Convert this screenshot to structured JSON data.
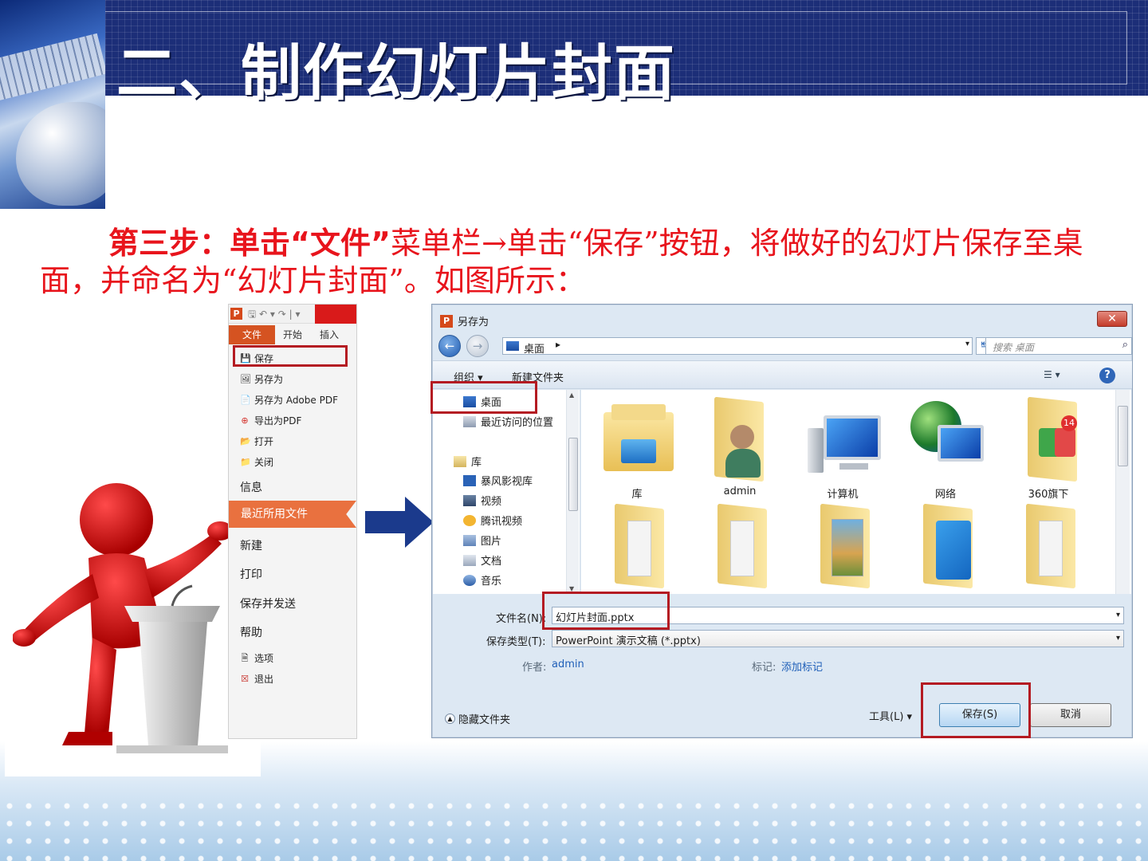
{
  "slide": {
    "title": "二、制作幻灯片封面",
    "instruction_lead": "第三步：单击“文件”",
    "instruction_rest": "菜单栏→单击“保存”按钮，将做好的幻灯片保存至桌面，并命名为“幻灯片封面”。如图所示："
  },
  "colors": {
    "title_bar": "#1c2e78",
    "instruction_text": "#e8141c",
    "highlight_box": "#b41b22",
    "file_tab": "#d55321",
    "recent_active": "#e9713f",
    "arrow": "#1b3a8c"
  },
  "backstage": {
    "app_icon": "P",
    "quick_access_glyphs": "🖫 ↶ ▾ ↷ | ▾",
    "tabs": {
      "file": "文件",
      "home": "开始",
      "insert": "插入"
    },
    "items": [
      {
        "label": "保存",
        "icon": "save-icon",
        "glyph": "💾"
      },
      {
        "label": "另存为",
        "icon": "save-as-icon",
        "glyph": "🖼"
      },
      {
        "label": "另存为 Adobe PDF",
        "icon": "adobe-pdf-icon",
        "glyph": "📄"
      },
      {
        "label": "导出为PDF",
        "icon": "export-pdf-icon",
        "glyph": "⊕"
      },
      {
        "label": "打开",
        "icon": "open-folder-icon",
        "glyph": "📂"
      },
      {
        "label": "关闭",
        "icon": "close-file-icon",
        "glyph": "📁"
      }
    ],
    "sections": {
      "info": "信息",
      "recent": "最近所用文件",
      "new": "新建",
      "print": "打印",
      "save_send": "保存并发送",
      "help": "帮助"
    },
    "bottom_items": [
      {
        "label": "选项",
        "icon": "options-icon",
        "glyph": "🗎"
      },
      {
        "label": "退出",
        "icon": "exit-icon",
        "glyph": "☒"
      }
    ]
  },
  "dialog": {
    "title": "另存为",
    "close_glyph": "✕",
    "back_glyph": "←",
    "forward_glyph": "→",
    "address_path": "桌面",
    "address_chevron": "▸",
    "dropdown_glyph": "▾",
    "refresh_glyph": "↹",
    "search_placeholder": "搜索 桌面",
    "search_glyph": "⌕",
    "toolbar": {
      "organize": "组织 ▾",
      "new_folder": "新建文件夹",
      "view": "☰ ▾",
      "help": "?"
    },
    "nav_items": [
      {
        "label": "桌面",
        "icon": "desktop-icon"
      },
      {
        "label": "最近访问的位置",
        "icon": "recent-places-icon"
      },
      {
        "label": "库",
        "icon": "libraries-icon"
      },
      {
        "label": "暴风影视库",
        "icon": "video-library-icon"
      },
      {
        "label": "视频",
        "icon": "videos-icon"
      },
      {
        "label": "腾讯视频",
        "icon": "tencent-video-icon"
      },
      {
        "label": "图片",
        "icon": "pictures-icon"
      },
      {
        "label": "文档",
        "icon": "documents-icon"
      },
      {
        "label": "音乐",
        "icon": "music-icon"
      }
    ],
    "files_row1": [
      {
        "name": "库",
        "icon": "libraries-folder-icon"
      },
      {
        "name": "admin",
        "icon": "user-folder-icon"
      },
      {
        "name": "计算机",
        "icon": "computer-icon"
      },
      {
        "name": "网络",
        "icon": "network-icon"
      },
      {
        "name": "360旗下",
        "icon": "folder-360-icon",
        "badge": "14"
      }
    ],
    "files_row2": [
      {
        "name": "",
        "icon": "folder-icon"
      },
      {
        "name": "",
        "icon": "folder-icon"
      },
      {
        "name": "",
        "icon": "folder-image-icon"
      },
      {
        "name": "",
        "icon": "folder-blue-icon"
      },
      {
        "name": "",
        "icon": "folder-icon"
      }
    ],
    "file_name_label": "文件名(N):",
    "file_name_value": "幻灯片封面.pptx",
    "save_type_label": "保存类型(T):",
    "save_type_value": "PowerPoint 演示文稿 (*.pptx)",
    "author_label": "作者:",
    "author_value": "admin",
    "tags_label": "标记:",
    "tags_value": "添加标记",
    "hide_folders": "隐藏文件夹",
    "tools": "工具(L) ▾",
    "save_button": "保存(S)",
    "cancel_button": "取消"
  }
}
